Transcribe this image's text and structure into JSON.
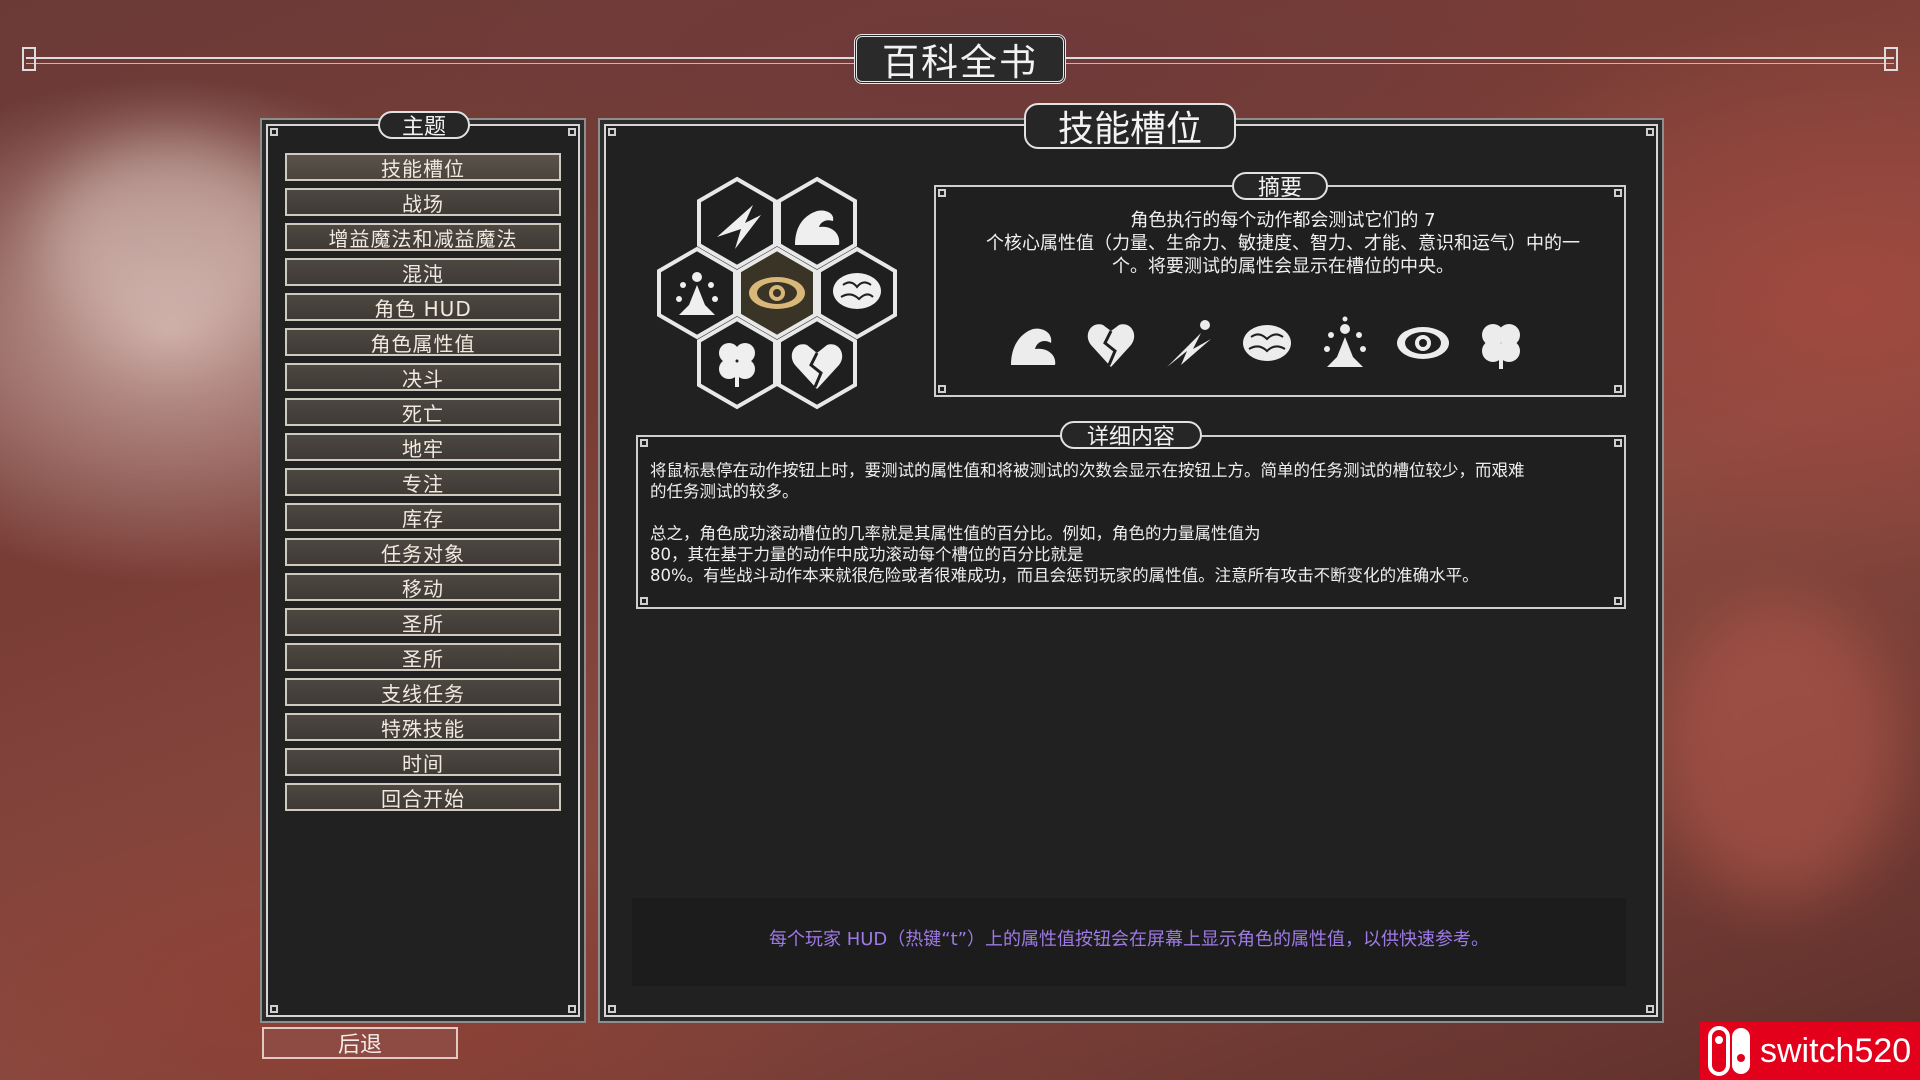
{
  "header": {
    "title": "百科全书"
  },
  "sidebar": {
    "heading": "主题",
    "items": [
      "技能槽位",
      "战场",
      "增益魔法和减益魔法",
      "混沌",
      "角色 HUD",
      "角色属性值",
      "决斗",
      "死亡",
      "地牢",
      "专注",
      "库存",
      "任务对象",
      "移动",
      "圣所",
      "圣所",
      "支线任务",
      "特殊技能",
      "时间",
      "回合开始"
    ],
    "active_index": 0
  },
  "back_button": {
    "label": "后退"
  },
  "main": {
    "title": "技能槽位",
    "hex_icons": [
      "swift-icon",
      "strength-icon",
      "willpower-icon",
      "awareness-icon",
      "intelligence-icon",
      "luck-icon",
      "vitality-icon"
    ],
    "summary": {
      "heading": "摘要",
      "lines": [
        "角色执行的每个动作都会测试它们的 7",
        "个核心属性值（力量、生命力、敏捷度、智力、才能、意识和运气）中的一",
        "个。将要测试的属性会显示在槽位的中央。"
      ],
      "stat_icons": [
        "strength-icon",
        "vitality-icon",
        "speed-icon",
        "intelligence-icon",
        "willpower-icon",
        "awareness-icon",
        "luck-icon"
      ]
    },
    "detail": {
      "heading": "详细内容",
      "paragraph1": [
        "将鼠标悬停在动作按钮上时，要测试的属性值和将被测试的次数会显示在按钮上方。简单的任务测试的槽位较少，而艰难",
        "的任务测试的较多。"
      ],
      "paragraph2": [
        "总之，角色成功滚动槽位的几率就是其属性值的百分比。例如，角色的力量属性值为",
        "80，其在基于力量的动作中成功滚动每个槽位的百分比就是",
        "80%。有些战斗动作本来就很危险或者很难成功，而且会惩罚玩家的属性值。注意所有攻击不断变化的准确水平。"
      ]
    },
    "hint": "每个玩家 HUD（热键“t”）上的属性值按钮会在屏幕上显示角色的属性值，以供快速参考。"
  },
  "watermark": {
    "text": "switch520"
  },
  "colors": {
    "accent_hint": "#9f7ae6",
    "back_button": "#8d4b44",
    "panel_bg": "#212121"
  }
}
